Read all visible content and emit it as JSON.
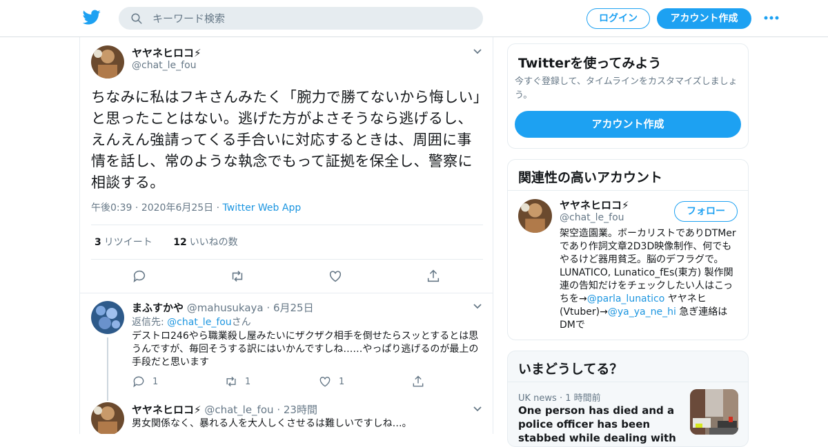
{
  "header": {
    "search_placeholder": "キーワード検索",
    "login_label": "ログイン",
    "signup_label": "アカウント作成"
  },
  "tweet": {
    "author_name": "ヤヤネヒロコ⚡",
    "author_handle": "@chat_le_fou",
    "text": "ちなみに私はフキさんみたく「腕力で勝てないから悔しい」と思ったことはない。逃げた方がよさそうなら逃げるし、えんえん強請ってくる手合いに対応するときは、周囲に事情を話し、常のような執念でもって証拠を保全し、警察に相談する。",
    "time": "午後0:39",
    "date": "2020年6月25日",
    "source": "Twitter Web App",
    "retweet_count": "3",
    "retweet_label": "リツイート",
    "like_count": "12",
    "like_label": "いいねの数"
  },
  "replies": [
    {
      "name": "まふすかや",
      "handle": "@mahusukaya",
      "time": "6月25日",
      "reply_to_label": "返信先:",
      "reply_to_handle": "@chat_le_fou",
      "reply_to_suffix": "さん",
      "text": "デストロ246やら職業殺し屋みたいにザクザク相手を倒せたらスッとするとは思うんですが、毎回そうする訳にはいかんですしね……やっぱり逃げるのが最上の手段だと思います",
      "reply_count": "1",
      "retweet_count": "1",
      "like_count": "1"
    },
    {
      "name": "ヤヤネヒロコ⚡",
      "handle": "@chat_le_fou",
      "time": "23時間",
      "text": "男女関係なく、暴れる人を大人しくさせるは難しいですしね…。"
    }
  ],
  "signup_card": {
    "title": "Twitterを使ってみよう",
    "desc": "今すぐ登録して、タイムラインをカスタマイズしましょう。",
    "button": "アカウント作成"
  },
  "related_card": {
    "title": "関連性の高いアカウント",
    "name": "ヤヤネヒロコ⚡",
    "handle": "@chat_le_fou",
    "follow_label": "フォロー",
    "bio_part1": "架空造園業。ボーカリストでありDTMerであり作詞文章2D3D映像制作、何でもやるけど器用貧乏。脳のデフラグで。LUNATICO, Lunatico_fEs(東方) 製作関連の告知だけをチェックしたい人はこっちを→",
    "bio_link1": "@parla_lunatico",
    "bio_part2": " ヤヤネヒ(Vtuber)→",
    "bio_link2": "@ya_ya_ne_hi",
    "bio_part3": " 急ぎ連絡はDMで"
  },
  "trends_card": {
    "title": "いまどうしてる？",
    "category": "UK news",
    "time": "1 時間前",
    "headline": "One person has died and a police officer has been stabbed while dealing with an incident in Glasgow"
  },
  "colors": {
    "accent": "#1da1f2",
    "link": "#1b95e0",
    "muted": "#657786"
  }
}
